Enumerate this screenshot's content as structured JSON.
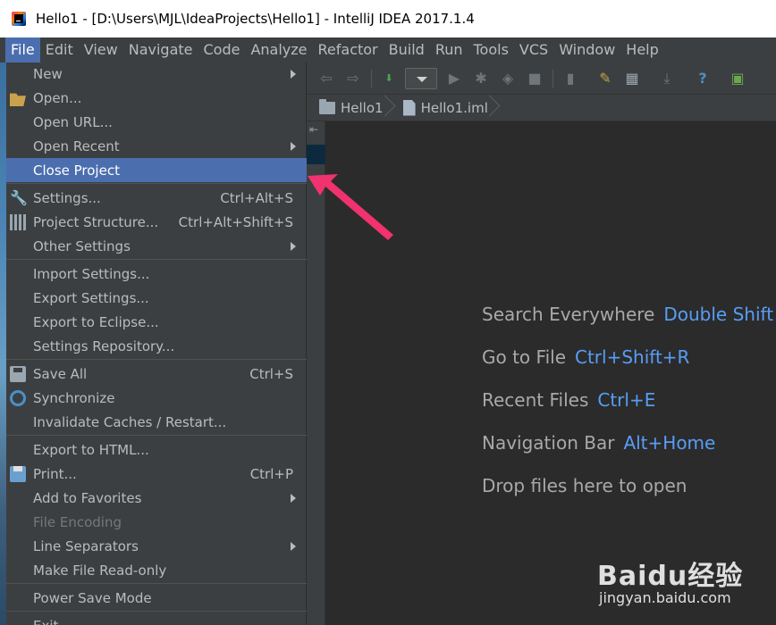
{
  "window": {
    "title": "Hello1 - [D:\\Users\\MJL\\IdeaProjects\\Hello1] - IntelliJ IDEA 2017.1.4"
  },
  "menubar": [
    "File",
    "Edit",
    "View",
    "Navigate",
    "Code",
    "Analyze",
    "Refactor",
    "Build",
    "Run",
    "Tools",
    "VCS",
    "Window",
    "Help"
  ],
  "file_menu": {
    "new": "New",
    "open": "Open...",
    "open_url": "Open URL...",
    "open_recent": "Open Recent",
    "close_project": "Close Project",
    "settings": "Settings...",
    "settings_sc": "Ctrl+Alt+S",
    "project_structure": "Project Structure...",
    "project_structure_sc": "Ctrl+Alt+Shift+S",
    "other_settings": "Other Settings",
    "import_settings": "Import Settings...",
    "export_settings": "Export Settings...",
    "export_eclipse": "Export to Eclipse...",
    "settings_repo": "Settings Repository...",
    "save_all": "Save All",
    "save_all_sc": "Ctrl+S",
    "synchronize": "Synchronize",
    "invalidate": "Invalidate Caches / Restart...",
    "export_html": "Export to HTML...",
    "print": "Print...",
    "print_sc": "Ctrl+P",
    "add_favorites": "Add to Favorites",
    "file_encoding": "File Encoding",
    "line_separators": "Line Separators",
    "make_readonly": "Make File Read-only",
    "power_save": "Power Save Mode",
    "exit": "Exit"
  },
  "breadcrumb": [
    "Hello1",
    "Hello1.iml"
  ],
  "editor_hints": [
    {
      "label": "Search Everywhere",
      "key": "Double Shift"
    },
    {
      "label": "Go to File",
      "key": "Ctrl+Shift+R"
    },
    {
      "label": "Recent Files",
      "key": "Ctrl+E"
    },
    {
      "label": "Navigation Bar",
      "key": "Alt+Home"
    },
    {
      "label": "Drop files here to open",
      "key": ""
    }
  ],
  "watermark": {
    "brand": "Baidu经验",
    "site": "jingyan.baidu.com"
  },
  "colors": {
    "menu_bg": "#3c3f41",
    "highlight": "#4b6eaf",
    "editor_bg": "#2b2b2b",
    "hint_key": "#589df6",
    "pointer": "#f0326e"
  }
}
